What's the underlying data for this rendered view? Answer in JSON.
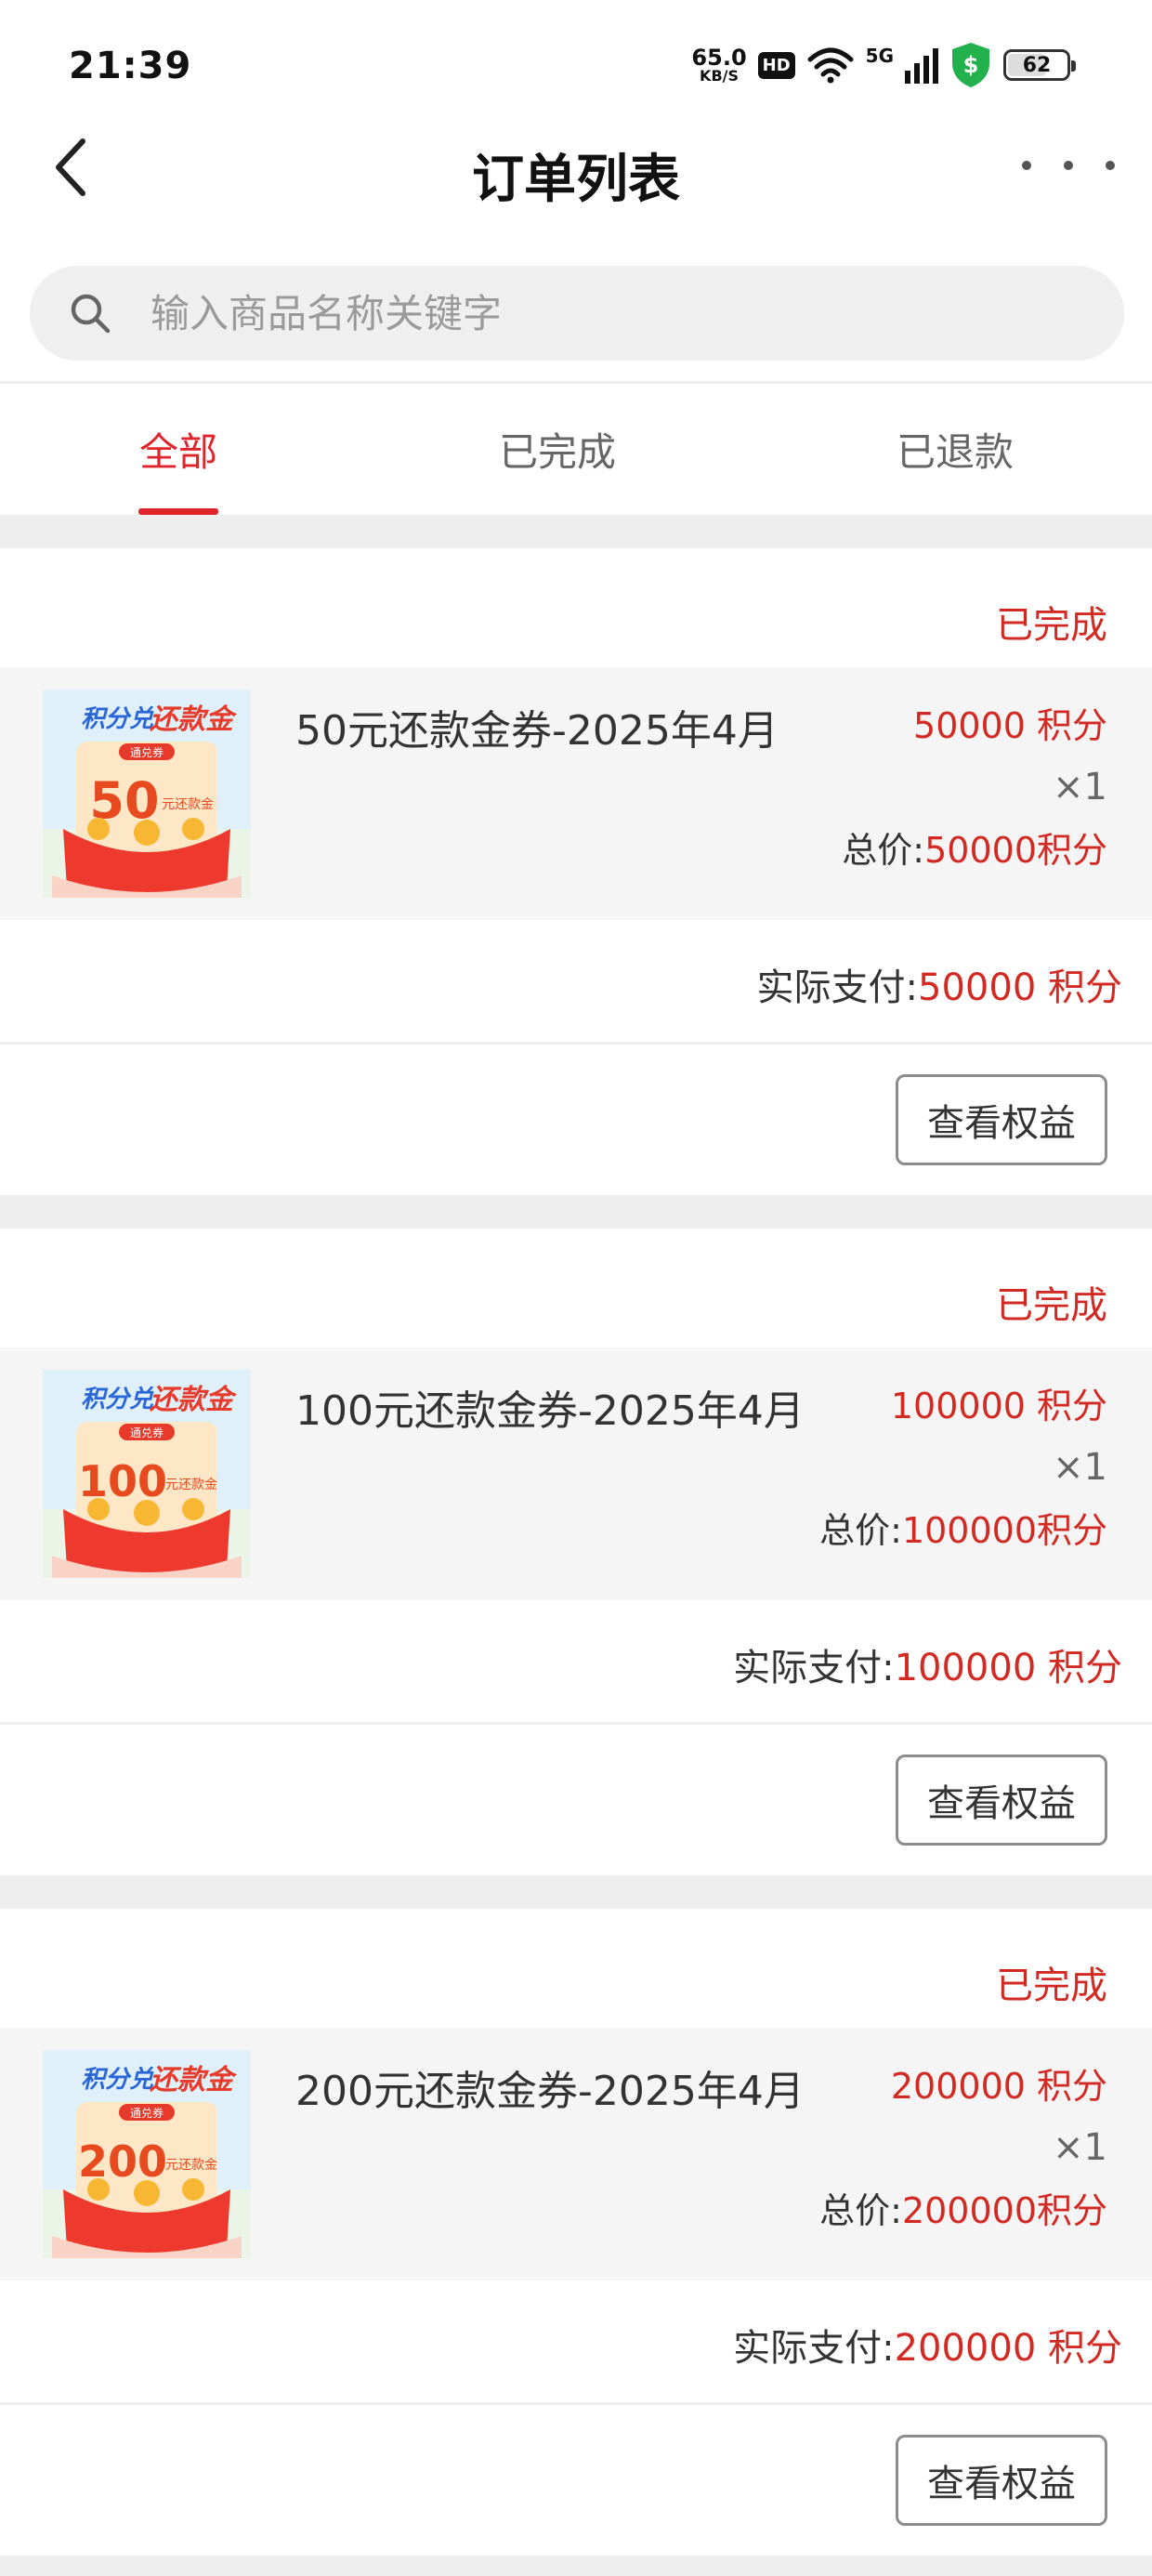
{
  "status_bar": {
    "time": "21:39",
    "net_speed": "65.0",
    "net_unit": "KB/S",
    "hd": "HD",
    "signal": "5G",
    "battery": "62"
  },
  "nav": {
    "title": "订单列表"
  },
  "search": {
    "placeholder": "输入商品名称关键字"
  },
  "tabs": [
    {
      "label": "全部",
      "active": true
    },
    {
      "label": "已完成",
      "active": false
    },
    {
      "label": "已退款",
      "active": false
    }
  ],
  "orders": [
    {
      "status": "已完成",
      "product_name": "50元还款金券-2025年4月",
      "price": "50000 积分",
      "qty": "×1",
      "total_label": "总价:",
      "total_value": "50000积分",
      "pay_label": "实际支付:",
      "pay_value": "50000 积分",
      "action": "查看权益",
      "thumb": {
        "title_a": "积分兑",
        "title_b": "还款金",
        "tag": "通兑券",
        "amount": "50",
        "unit": "元还款金"
      }
    },
    {
      "status": "已完成",
      "product_name": "100元还款金券-2025年4月",
      "price": "100000 积分",
      "qty": "×1",
      "total_label": "总价:",
      "total_value": "100000积分",
      "pay_label": "实际支付:",
      "pay_value": "100000 积分",
      "action": "查看权益",
      "thumb": {
        "title_a": "积分兑",
        "title_b": "还款金",
        "tag": "通兑券",
        "amount": "100",
        "unit": "元还款金"
      }
    },
    {
      "status": "已完成",
      "product_name": "200元还款金券-2025年4月",
      "price": "200000 积分",
      "qty": "×1",
      "total_label": "总价:",
      "total_value": "200000积分",
      "pay_label": "实际支付:",
      "pay_value": "200000 积分",
      "action": "查看权益",
      "thumb": {
        "title_a": "积分兑",
        "title_b": "还款金",
        "tag": "通兑券",
        "amount": "200",
        "unit": "元还款金"
      }
    }
  ],
  "colors": {
    "accent": "#e0242b",
    "price_red": "#d22a23",
    "separator": "#eeeeee",
    "product_bg": "#f5f5f5"
  }
}
